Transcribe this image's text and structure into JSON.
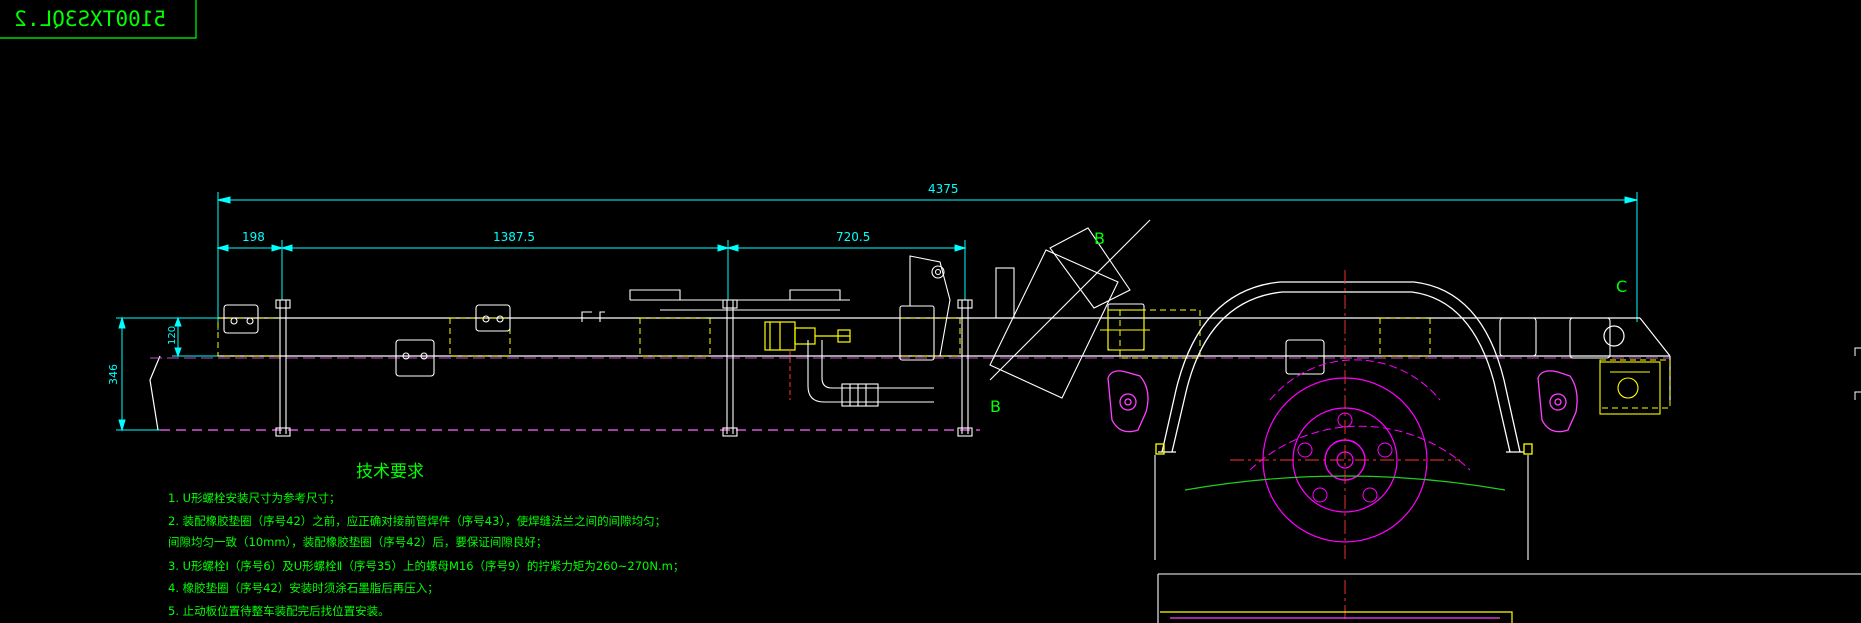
{
  "title_block": {
    "code": "5100TXS3QL.2"
  },
  "dimensions": {
    "overall": "4375",
    "d1": "198",
    "d2": "1387.5",
    "d3": "720.5",
    "v1": "120",
    "v2": "346"
  },
  "section_labels": {
    "b_top": "B",
    "b_bottom": "B",
    "c": "C"
  },
  "notes": {
    "heading": "技术要求",
    "lines": [
      "1. U形螺栓安装尺寸为参考尺寸；",
      "2. 装配橡胶垫圈（序号42）之前，应正确对接前管焊件（序号43），使焊缝法兰之间的间隙均匀；",
      "   间隙均匀一致（10mm），装配橡胶垫圈（序号42）后，要保证间隙良好；",
      "3. U形螺栓Ⅰ（序号6）及U形螺栓Ⅱ（序号35）上的螺母M16（序号9）的拧紧力矩为260~270N.m；",
      "4. 橡胶垫圈（序号42）安装时须涂石墨脂后再压入；",
      "5. 止动板位置待整车装配完后找位置安装。"
    ]
  },
  "colors": {
    "background": "#000000",
    "frame": "#ffffff",
    "dimension": "#00ffff",
    "notes": "#00ff00",
    "hidden": "#ffff00",
    "hub": "#ff00ff",
    "center": "#ff3333",
    "mount": "#ff40ff"
  }
}
